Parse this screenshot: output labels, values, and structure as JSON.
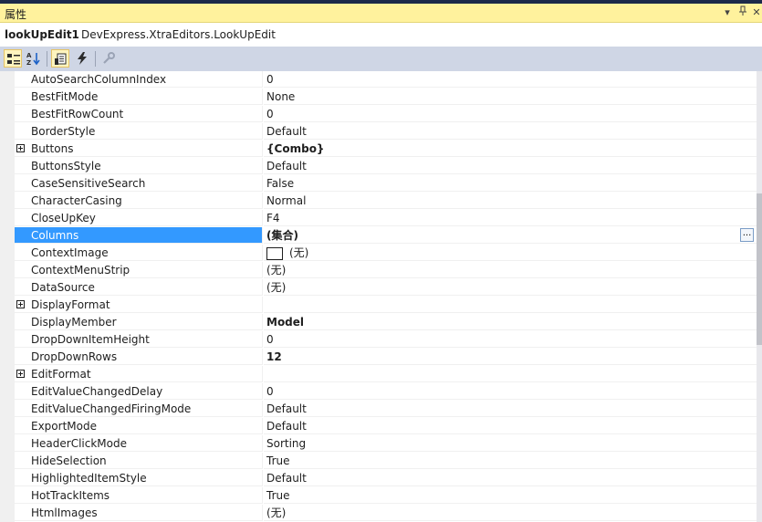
{
  "panel": {
    "title": "属性",
    "btn_dropdown": "▾",
    "btn_pin": "Ⅱ",
    "btn_close": "✕"
  },
  "object": {
    "name": "lookUpEdit1",
    "type": "DevExpress.XtraEditors.LookUpEdit"
  },
  "toolbar": {
    "buttons": [
      "categorized",
      "alphabetical",
      "properties",
      "events",
      "property-pages"
    ]
  },
  "properties": [
    {
      "name": "AutoSearchColumnIndex",
      "value": "0"
    },
    {
      "name": "BestFitMode",
      "value": "None"
    },
    {
      "name": "BestFitRowCount",
      "value": "0"
    },
    {
      "name": "BorderStyle",
      "value": "Default"
    },
    {
      "name": "Buttons",
      "value": "{Combo}",
      "bold": true,
      "expandable": true
    },
    {
      "name": "ButtonsStyle",
      "value": "Default"
    },
    {
      "name": "CaseSensitiveSearch",
      "value": "False"
    },
    {
      "name": "CharacterCasing",
      "value": "Normal"
    },
    {
      "name": "CloseUpKey",
      "value": "F4"
    },
    {
      "name": "Columns",
      "value": "(集合)",
      "bold": true,
      "selected": true,
      "ellipsis": "..."
    },
    {
      "name": "ContextImage",
      "value": "(无)",
      "swatch": true
    },
    {
      "name": "ContextMenuStrip",
      "value": "(无)"
    },
    {
      "name": "DataSource",
      "value": "(无)"
    },
    {
      "name": "DisplayFormat",
      "value": "",
      "expandable": true
    },
    {
      "name": "DisplayMember",
      "value": "Model",
      "bold": true
    },
    {
      "name": "DropDownItemHeight",
      "value": "0"
    },
    {
      "name": "DropDownRows",
      "value": "12",
      "bold": true
    },
    {
      "name": "EditFormat",
      "value": "",
      "expandable": true
    },
    {
      "name": "EditValueChangedDelay",
      "value": "0"
    },
    {
      "name": "EditValueChangedFiringMode",
      "value": "Default"
    },
    {
      "name": "ExportMode",
      "value": "Default"
    },
    {
      "name": "HeaderClickMode",
      "value": "Sorting"
    },
    {
      "name": "HideSelection",
      "value": "True"
    },
    {
      "name": "HighlightedItemStyle",
      "value": "Default"
    },
    {
      "name": "HotTrackItems",
      "value": "True"
    },
    {
      "name": "HtmlImages",
      "value": "(无)"
    }
  ]
}
